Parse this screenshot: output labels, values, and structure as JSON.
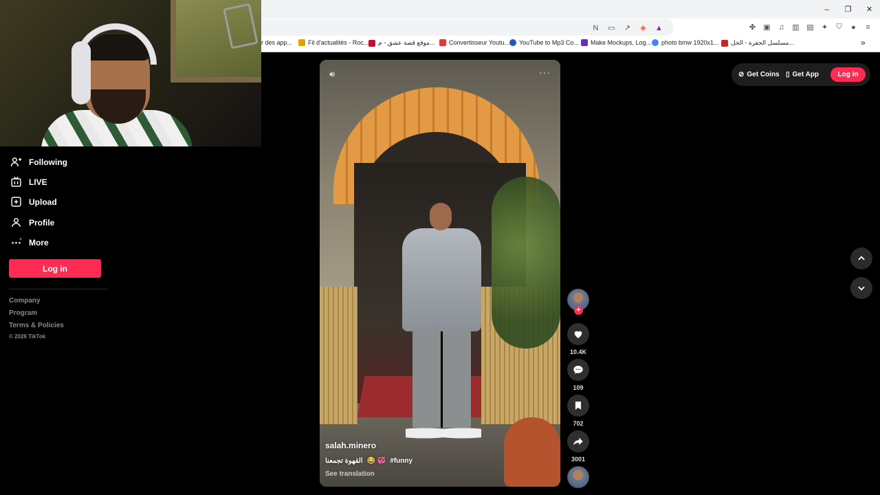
{
  "browser": {
    "window_buttons": {
      "minimize": "–",
      "restore": "❐",
      "close": "✕"
    },
    "bookmarks": [
      {
        "label": "r des app...",
        "color": "#ffffff"
      },
      {
        "label": "Fil d'actualités - Roc...",
        "color": "#e6a100"
      },
      {
        "label": "موقع قصة عشق - م...",
        "color": "#c8102e"
      },
      {
        "label": "Convertisseur Youtu...",
        "color": "#e53935"
      },
      {
        "label": "YouTube to Mp3 Co...",
        "color": "#1e5ab4"
      },
      {
        "label": "Make Mockups, Log...",
        "color": "#6b2fbf"
      },
      {
        "label": "photo bmw 1920x1...",
        "color": "#4285f4"
      },
      {
        "label": "مسلسل الحفرة - الحل...",
        "color": "#c62828"
      }
    ],
    "more_bookmarks": "»"
  },
  "sidebar": {
    "items": [
      {
        "label": "Following",
        "icon": "following-icon"
      },
      {
        "label": "LIVE",
        "icon": "live-icon"
      },
      {
        "label": "Upload",
        "icon": "upload-icon"
      },
      {
        "label": "Profile",
        "icon": "profile-icon"
      },
      {
        "label": "More",
        "icon": "more-icon"
      }
    ],
    "login_label": "Log in",
    "footer_links": [
      "Company",
      "Program",
      "Terms & Policies"
    ],
    "copyright": "© 2026 TikTok"
  },
  "video": {
    "username": "salah.minero",
    "caption_text": "القهوة تجمعنا",
    "caption_emoji": "😂 💞",
    "hashtag": "#funny",
    "see_translation": "See translation",
    "more_dots": "···"
  },
  "actions": {
    "likes": "10.4K",
    "comments": "109",
    "saves": "702",
    "shares": "3001"
  },
  "header": {
    "get_coins": "Get Coins",
    "get_app": "Get App",
    "login": "Log in"
  },
  "colors": {
    "accent": "#fe2c55",
    "background": "#000000"
  }
}
